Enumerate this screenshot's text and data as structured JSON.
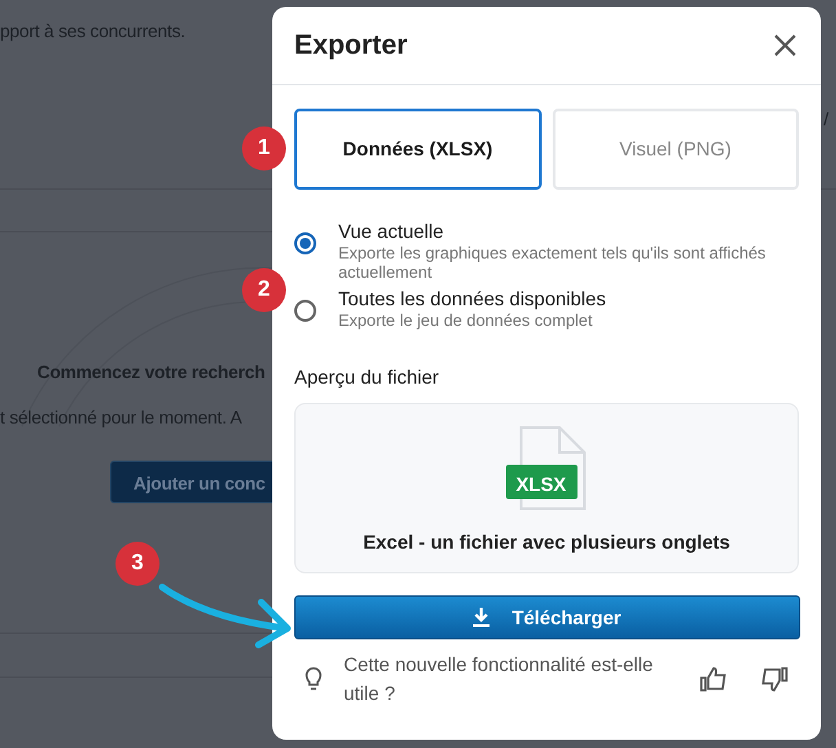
{
  "background": {
    "intro": "pport à ses concurrents.",
    "column_fragment": "/",
    "empty_title": "Commencez votre recherch",
    "empty_text": "t sélectionné pour le moment. A",
    "empty_button": "Ajouter un conc"
  },
  "modal": {
    "title": "Exporter",
    "tabs": [
      {
        "label": "Données (XLSX)",
        "selected": true
      },
      {
        "label": "Visuel (PNG)",
        "selected": false
      }
    ],
    "options": [
      {
        "label": "Vue actuelle",
        "description": "Exporte les graphiques exactement tels qu'ils sont affichés actuellement",
        "selected": true
      },
      {
        "label": "Toutes les données disponibles",
        "description": "Exporte le jeu de données complet",
        "selected": false
      }
    ],
    "preview": {
      "heading": "Aperçu du fichier",
      "file_badge": "XLSX",
      "caption": "Excel - un fichier avec plusieurs onglets"
    },
    "download_button": "Télécharger",
    "feedback": {
      "question": "Cette nouvelle fonctionnalité est-elle utile ?"
    }
  },
  "annotations": [
    {
      "number": "1"
    },
    {
      "number": "2"
    },
    {
      "number": "3"
    }
  ]
}
